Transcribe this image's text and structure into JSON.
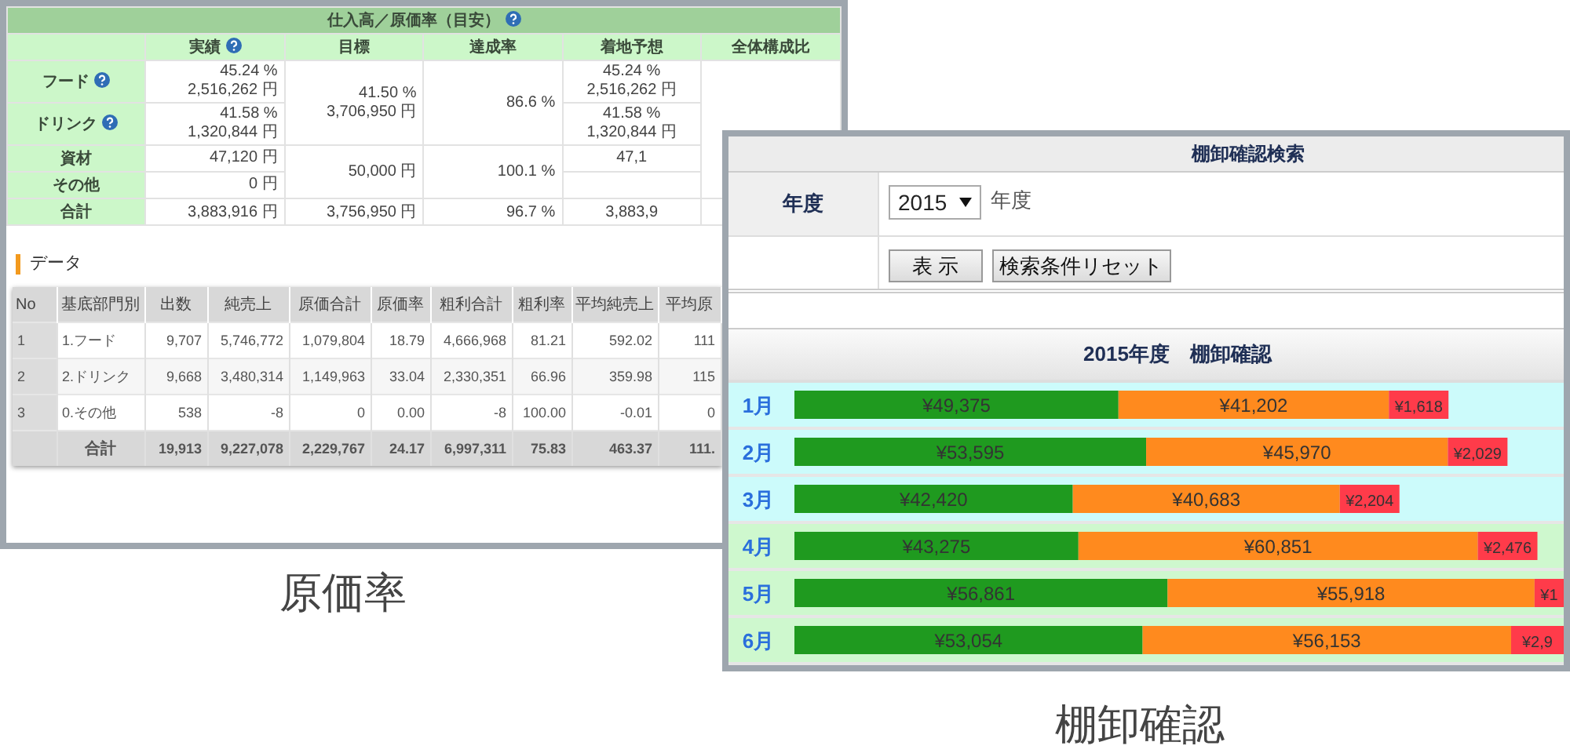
{
  "purchase_window": {
    "summary": {
      "title": "仕入高／原価率（目安）",
      "title_help": true,
      "columns": [
        {
          "label": "実績",
          "help": true
        },
        {
          "label": "目標",
          "help": false
        },
        {
          "label": "達成率",
          "help": false
        },
        {
          "label": "着地予想",
          "help": false
        },
        {
          "label": "全体構成比",
          "help": false
        }
      ],
      "groups": [
        {
          "rows": [
            {
              "label": "フード",
              "help": true,
              "actual": [
                "45.24 %",
                "2,516,262 円"
              ],
              "forecast": [
                "45.24 %",
                "2,516,262 円"
              ]
            },
            {
              "label": "ドリンク",
              "help": true,
              "actual": [
                "41.58 %",
                "1,320,844 円"
              ],
              "forecast": [
                "41.58 %",
                "1,320,844 円"
              ]
            }
          ],
          "target": [
            "41.50 %",
            "3,706,950 円"
          ],
          "achievement": "86.6 %"
        },
        {
          "rows": [
            {
              "label": "資材",
              "help": false,
              "actual": [
                "47,120 円"
              ],
              "forecast": [
                "47,1"
              ]
            },
            {
              "label": "その他",
              "help": false,
              "actual": [
                "0 円"
              ]
            }
          ],
          "target": [
            "50,000 円"
          ],
          "achievement": "100.1 %"
        }
      ],
      "total": {
        "label": "合計",
        "actual": "3,883,916 円",
        "target": "3,756,950 円",
        "achievement": "96.7 %",
        "forecast": "3,883,9"
      }
    },
    "data": {
      "heading": "データ",
      "columns": [
        "No",
        "基底部門別",
        "出数",
        "純売上",
        "原価合計",
        "原価率",
        "粗利合計",
        "粗利率",
        "平均純売上",
        "平均原"
      ],
      "rows": [
        [
          "1",
          "1.フード",
          "9,707",
          "5,746,772",
          "1,079,804",
          "18.79",
          "4,666,968",
          "81.21",
          "592.02",
          "111"
        ],
        [
          "2",
          "2.ドリンク",
          "9,668",
          "3,480,314",
          "1,149,963",
          "33.04",
          "2,330,351",
          "66.96",
          "359.98",
          "115"
        ],
        [
          "3",
          "0.その他",
          "538",
          "-8",
          "0",
          "0.00",
          "-8",
          "100.00",
          "-0.01",
          "0"
        ]
      ],
      "total": {
        "label": "合計",
        "values": [
          "19,913",
          "9,227,078",
          "2,229,767",
          "24.17",
          "6,997,311",
          "75.83",
          "463.37",
          "111."
        ]
      }
    }
  },
  "inventory_window": {
    "search": {
      "title": "棚卸確認検索",
      "year_label": "年度",
      "year_value": "2015",
      "year_suffix": "年度",
      "buttons": [
        "表 示",
        "検索条件リセット"
      ]
    },
    "result": {
      "title": "2015年度　棚卸確認",
      "months": [
        {
          "label": "1月",
          "color": "#ccfbfb",
          "segments": [
            {
              "label": "¥49,375",
              "color": "#1f9a1f"
            },
            {
              "label": "¥41,202",
              "color": "#ff8a1e"
            },
            {
              "label": "¥1,618",
              "color": "#ff3b4a"
            }
          ]
        },
        {
          "label": "2月",
          "color": "#ccfbfb",
          "segments": [
            {
              "label": "¥53,595",
              "color": "#1f9a1f"
            },
            {
              "label": "¥45,970",
              "color": "#ff8a1e"
            },
            {
              "label": "¥2,029",
              "color": "#ff3b4a"
            }
          ]
        },
        {
          "label": "3月",
          "color": "#ccfbfb",
          "segments": [
            {
              "label": "¥42,420",
              "color": "#1f9a1f"
            },
            {
              "label": "¥40,683",
              "color": "#ff8a1e"
            },
            {
              "label": "¥2,204",
              "color": "#ff3b4a"
            }
          ]
        },
        {
          "label": "4月",
          "color": "#cef8ce",
          "segments": [
            {
              "label": "¥43,275",
              "color": "#1f9a1f"
            },
            {
              "label": "¥60,851",
              "color": "#ff8a1e"
            },
            {
              "label": "¥2,476",
              "color": "#ff3b4a"
            }
          ]
        },
        {
          "label": "5月",
          "color": "#cef8ce",
          "segments": [
            {
              "label": "¥56,861",
              "color": "#1f9a1f"
            },
            {
              "label": "¥55,918",
              "color": "#ff8a1e"
            },
            {
              "label": "¥1",
              "color": "#ff3b4a"
            }
          ]
        },
        {
          "label": "6月",
          "color": "#cef8ce",
          "segments": [
            {
              "label": "¥53,054",
              "color": "#1f9a1f"
            },
            {
              "label": "¥56,153",
              "color": "#ff8a1e"
            },
            {
              "label": "¥2,9",
              "color": "#ff3b4a"
            }
          ]
        }
      ]
    }
  },
  "captions": [
    "原価率",
    "棚卸確認"
  ]
}
